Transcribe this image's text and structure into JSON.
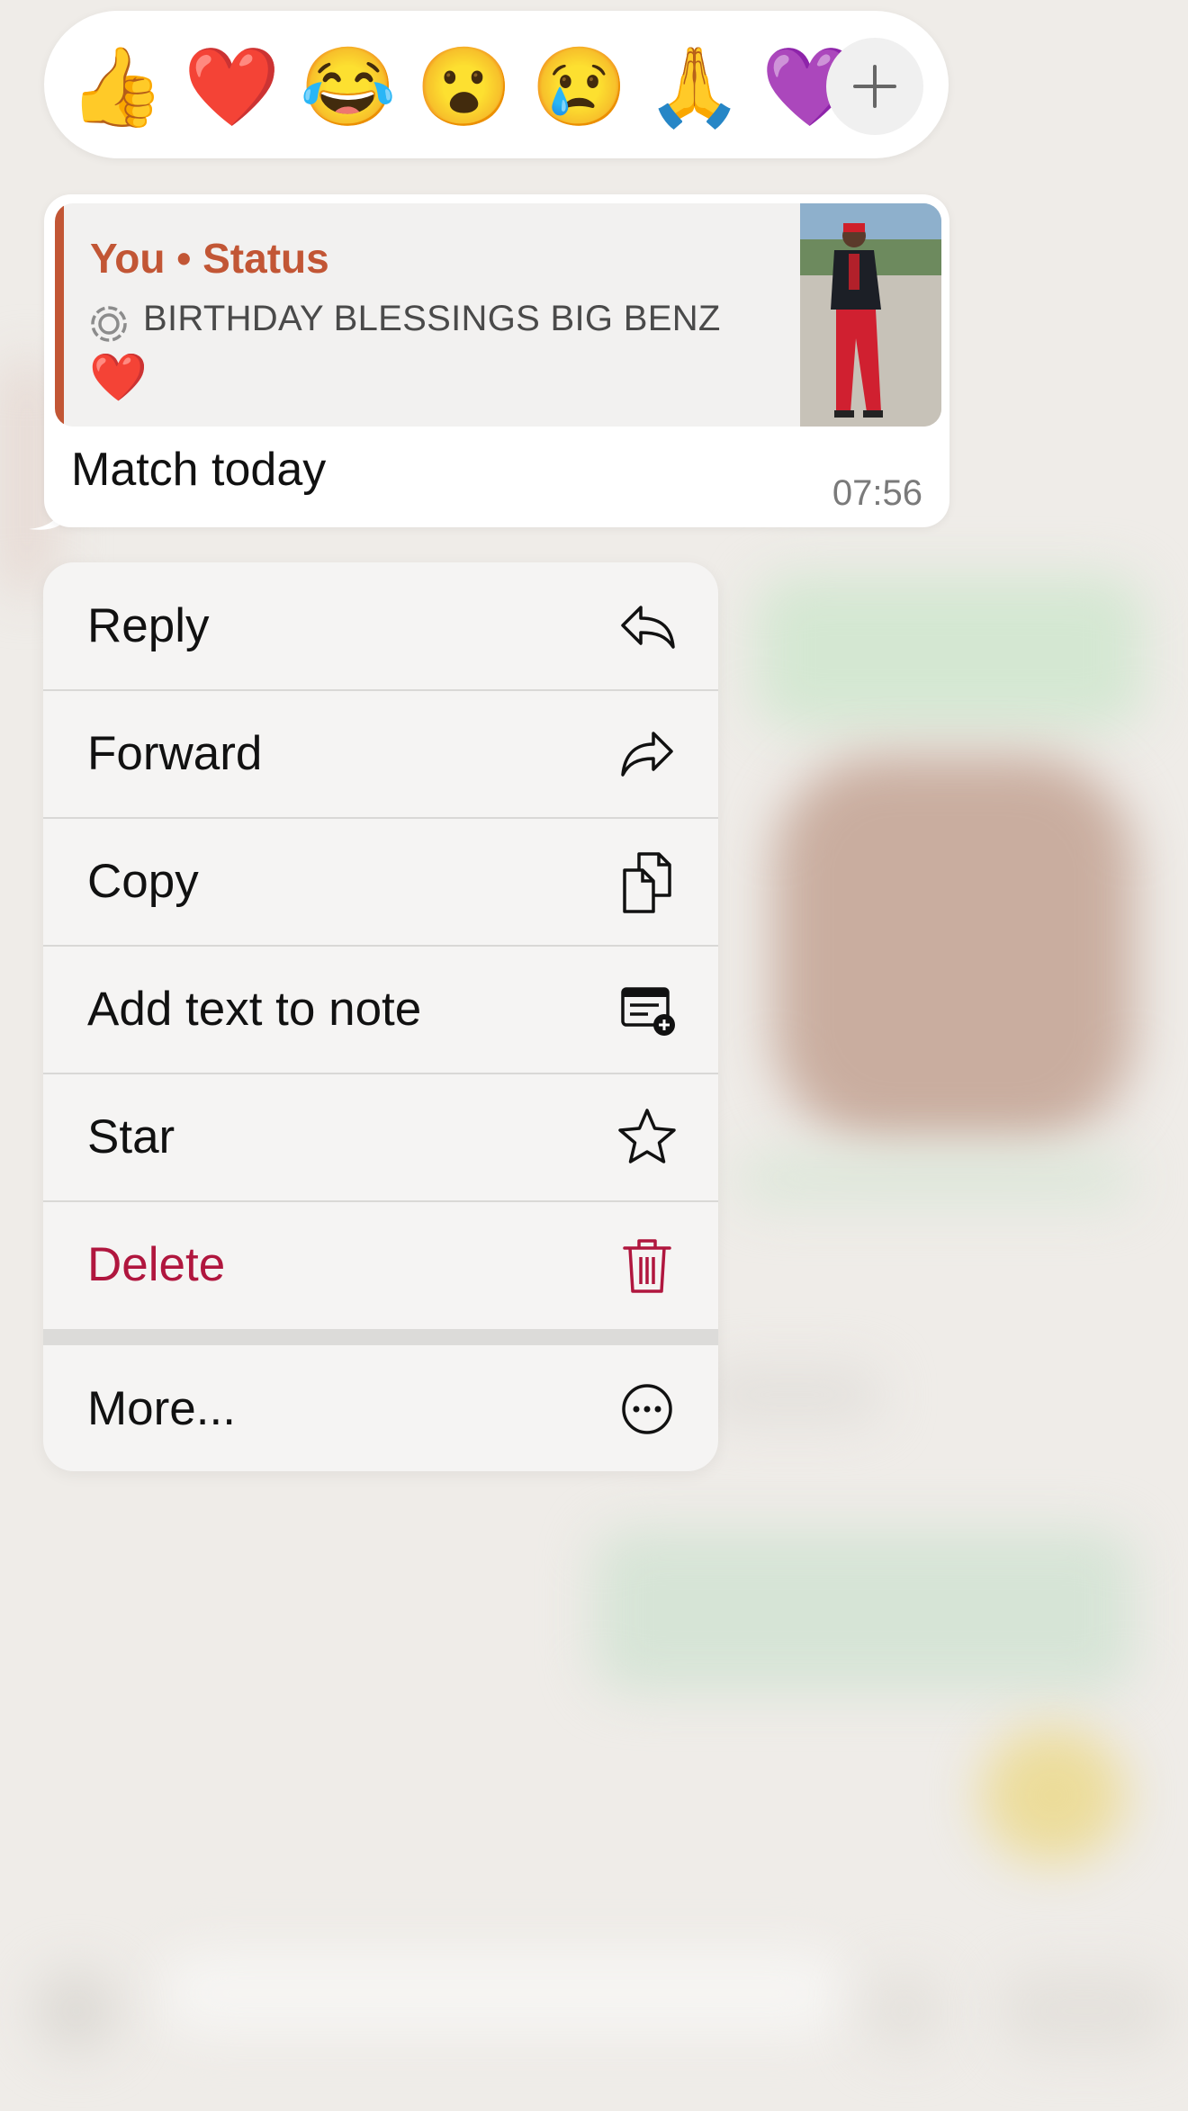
{
  "reactions": {
    "emojis": [
      {
        "glyph": "👍",
        "name": "thumbs-up"
      },
      {
        "glyph": "❤️",
        "name": "red-heart"
      },
      {
        "glyph": "😂",
        "name": "tears-of-joy"
      },
      {
        "glyph": "😮",
        "name": "open-mouth"
      },
      {
        "glyph": "😢",
        "name": "crying-face"
      },
      {
        "glyph": "🙏",
        "name": "folded-hands"
      },
      {
        "glyph": "💜",
        "name": "purple-heart"
      }
    ],
    "more_icon": "plus-icon"
  },
  "message": {
    "quote_author": "You • Status",
    "quote_text": "BIRTHDAY BLESSINGS BIG BENZ",
    "quote_emoji": "❤️",
    "text": "Match today",
    "time": "07:56",
    "accent_color": "#c25635"
  },
  "menu": {
    "items": [
      {
        "label": "Reply",
        "icon": "reply-icon"
      },
      {
        "label": "Forward",
        "icon": "forward-icon"
      },
      {
        "label": "Copy",
        "icon": "copy-icon"
      },
      {
        "label": "Add text to note",
        "icon": "note-add-icon"
      },
      {
        "label": "Star",
        "icon": "star-icon"
      },
      {
        "label": "Delete",
        "icon": "trash-icon",
        "color": "#b0163e"
      },
      {
        "label": "More...",
        "icon": "more-icon"
      }
    ]
  }
}
